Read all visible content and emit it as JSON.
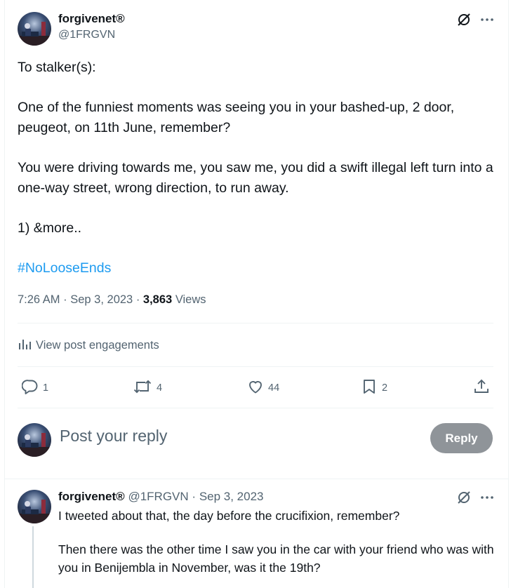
{
  "post": {
    "author_name": "forgivenet®",
    "author_handle": "@1FRGVN",
    "body": [
      "To stalker(s):",
      "One of the funniest moments was seeing you in your bashed-up, 2 door, peugeot, on 11th June, remember?",
      "You were driving towards me, you saw me, you did a swift illegal left turn into a one-way street, wrong direction, to run away.",
      "1) &more.."
    ],
    "hashtag": "#NoLooseEnds",
    "time": "7:26 AM",
    "date": "Sep 3, 2023",
    "views_count": "3,863",
    "views_label": "Views",
    "engagements_label": "View post engagements",
    "actions": {
      "replies": "1",
      "reposts": "4",
      "likes": "44",
      "bookmarks": "2"
    },
    "icons": [
      "grok-icon",
      "more-icon",
      "analytics-icon",
      "reply-icon",
      "repost-icon",
      "like-icon",
      "bookmark-icon",
      "share-icon"
    ]
  },
  "composer": {
    "placeholder": "Post your reply",
    "button_label": "Reply"
  },
  "reply": {
    "author_name": "forgivenet®",
    "author_handle": "@1FRGVN",
    "separator": "·",
    "date": "Sep 3, 2023",
    "body": [
      "I tweeted about that, the day before the crucifixion, remember?",
      "Then there was the other time I saw you in the car with your friend who was with you in Benijembla in November, was it the 19th?"
    ]
  },
  "colors": {
    "accent": "#1d9bf0",
    "muted": "#536471",
    "text": "#0f1419",
    "divider": "#eff3f4",
    "reply_button_disabled": "#8f9499"
  }
}
